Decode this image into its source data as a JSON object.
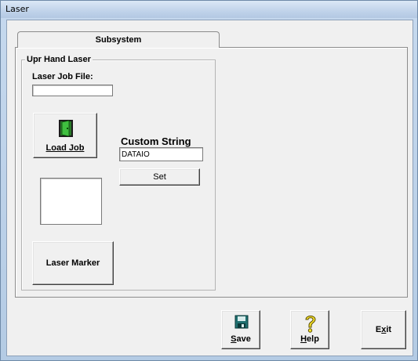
{
  "window": {
    "title": "Laser"
  },
  "tab": {
    "label": "Subsystem"
  },
  "group": {
    "title": "Upr Hand Laser"
  },
  "laser_job": {
    "label": "Laser Job File:",
    "value": ""
  },
  "buttons": {
    "load_job": {
      "label": "Load Job"
    },
    "laser_marker": {
      "label": "Laser Marker"
    },
    "set": {
      "label": "Set"
    },
    "save": {
      "label": "Save",
      "mnemonic": "S",
      "rest": "ave"
    },
    "help": {
      "label": "Help",
      "mnemonic": "H",
      "rest": "elp"
    },
    "exit": {
      "label": "Exit",
      "pre": "E",
      "mnemonic": "x",
      "rest": "it"
    }
  },
  "custom_string": {
    "label": "Custom String",
    "value": "DATAIO"
  },
  "icons": {
    "load_job": "door-open-icon",
    "save": "floppy-disk-icon",
    "help": "question-mark-icon"
  }
}
